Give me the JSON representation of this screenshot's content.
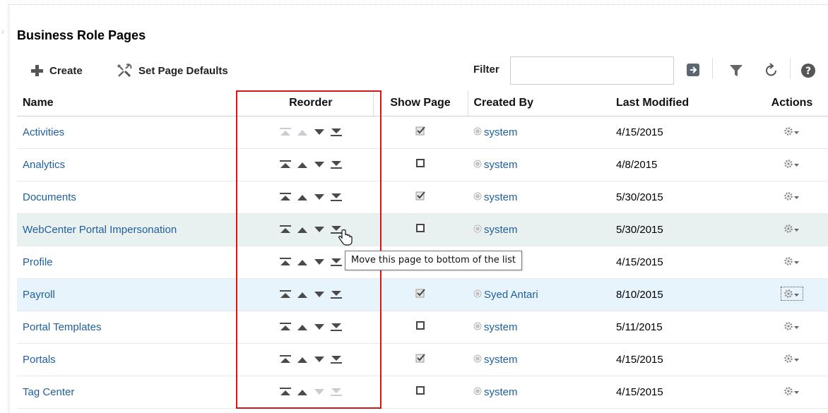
{
  "page": {
    "title": "Business Role Pages"
  },
  "toolbar": {
    "create_label": "Create",
    "defaults_label": "Set Page Defaults",
    "filter_label": "Filter",
    "filter_value": "",
    "icons": [
      "go-icon",
      "filter-funnel-icon",
      "refresh-icon",
      "help-icon"
    ]
  },
  "columns": {
    "name": "Name",
    "reorder": "Reorder",
    "show_page": "Show Page",
    "created_by": "Created By",
    "last_modified": "Last Modified",
    "actions": "Actions"
  },
  "rows": [
    {
      "name": "Activities",
      "show_page": true,
      "created_by": "system",
      "last_modified": "4/15/2015"
    },
    {
      "name": "Analytics",
      "show_page": false,
      "created_by": "system",
      "last_modified": "4/8/2015"
    },
    {
      "name": "Documents",
      "show_page": true,
      "created_by": "system",
      "last_modified": "5/30/2015"
    },
    {
      "name": "WebCenter Portal Impersonation",
      "show_page": false,
      "created_by": "system",
      "last_modified": "5/30/2015"
    },
    {
      "name": "Profile",
      "show_page": false,
      "created_by": "system",
      "last_modified": "4/15/2015"
    },
    {
      "name": "Payroll",
      "show_page": true,
      "created_by": "Syed Antari",
      "last_modified": "8/10/2015"
    },
    {
      "name": "Portal Templates",
      "show_page": false,
      "created_by": "system",
      "last_modified": "5/11/2015"
    },
    {
      "name": "Portals",
      "show_page": true,
      "created_by": "system",
      "last_modified": "4/15/2015"
    },
    {
      "name": "Tag Center",
      "show_page": false,
      "created_by": "system",
      "last_modified": "4/15/2015"
    }
  ],
  "tooltip": {
    "text": "Move this page to bottom of the list"
  },
  "colors": {
    "link": "#1f5f9e",
    "highlight": "#d01818",
    "selected_row": "#e8f4fb",
    "hover_row": "#e9f0f0"
  }
}
